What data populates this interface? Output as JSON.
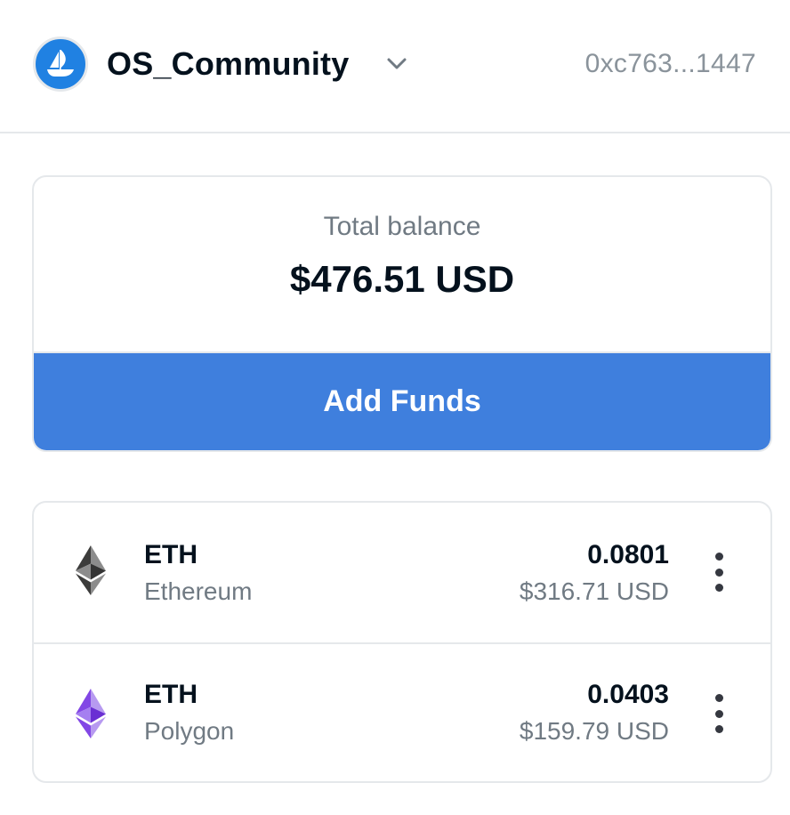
{
  "header": {
    "account_name": "OS_Community",
    "address": "0xc763...1447",
    "avatar_icon": "opensea-ship-icon",
    "dropdown_icon": "chevron-down-icon"
  },
  "balance": {
    "label": "Total balance",
    "value": "$476.51 USD",
    "add_funds_label": "Add Funds"
  },
  "tokens": [
    {
      "symbol": "ETH",
      "network": "Ethereum",
      "amount": "0.0801",
      "usd": "$316.71 USD",
      "icon": "ethereum-icon"
    },
    {
      "symbol": "ETH",
      "network": "Polygon",
      "amount": "0.0403",
      "usd": "$159.79 USD",
      "icon": "polygon-eth-icon"
    }
  ],
  "colors": {
    "accent": "#3f7fdd",
    "brand_blue": "#2081e2",
    "text_primary": "#04111d",
    "text_secondary": "#707a83",
    "border": "#e5e8eb",
    "polygon_purple": "#8247e5"
  }
}
